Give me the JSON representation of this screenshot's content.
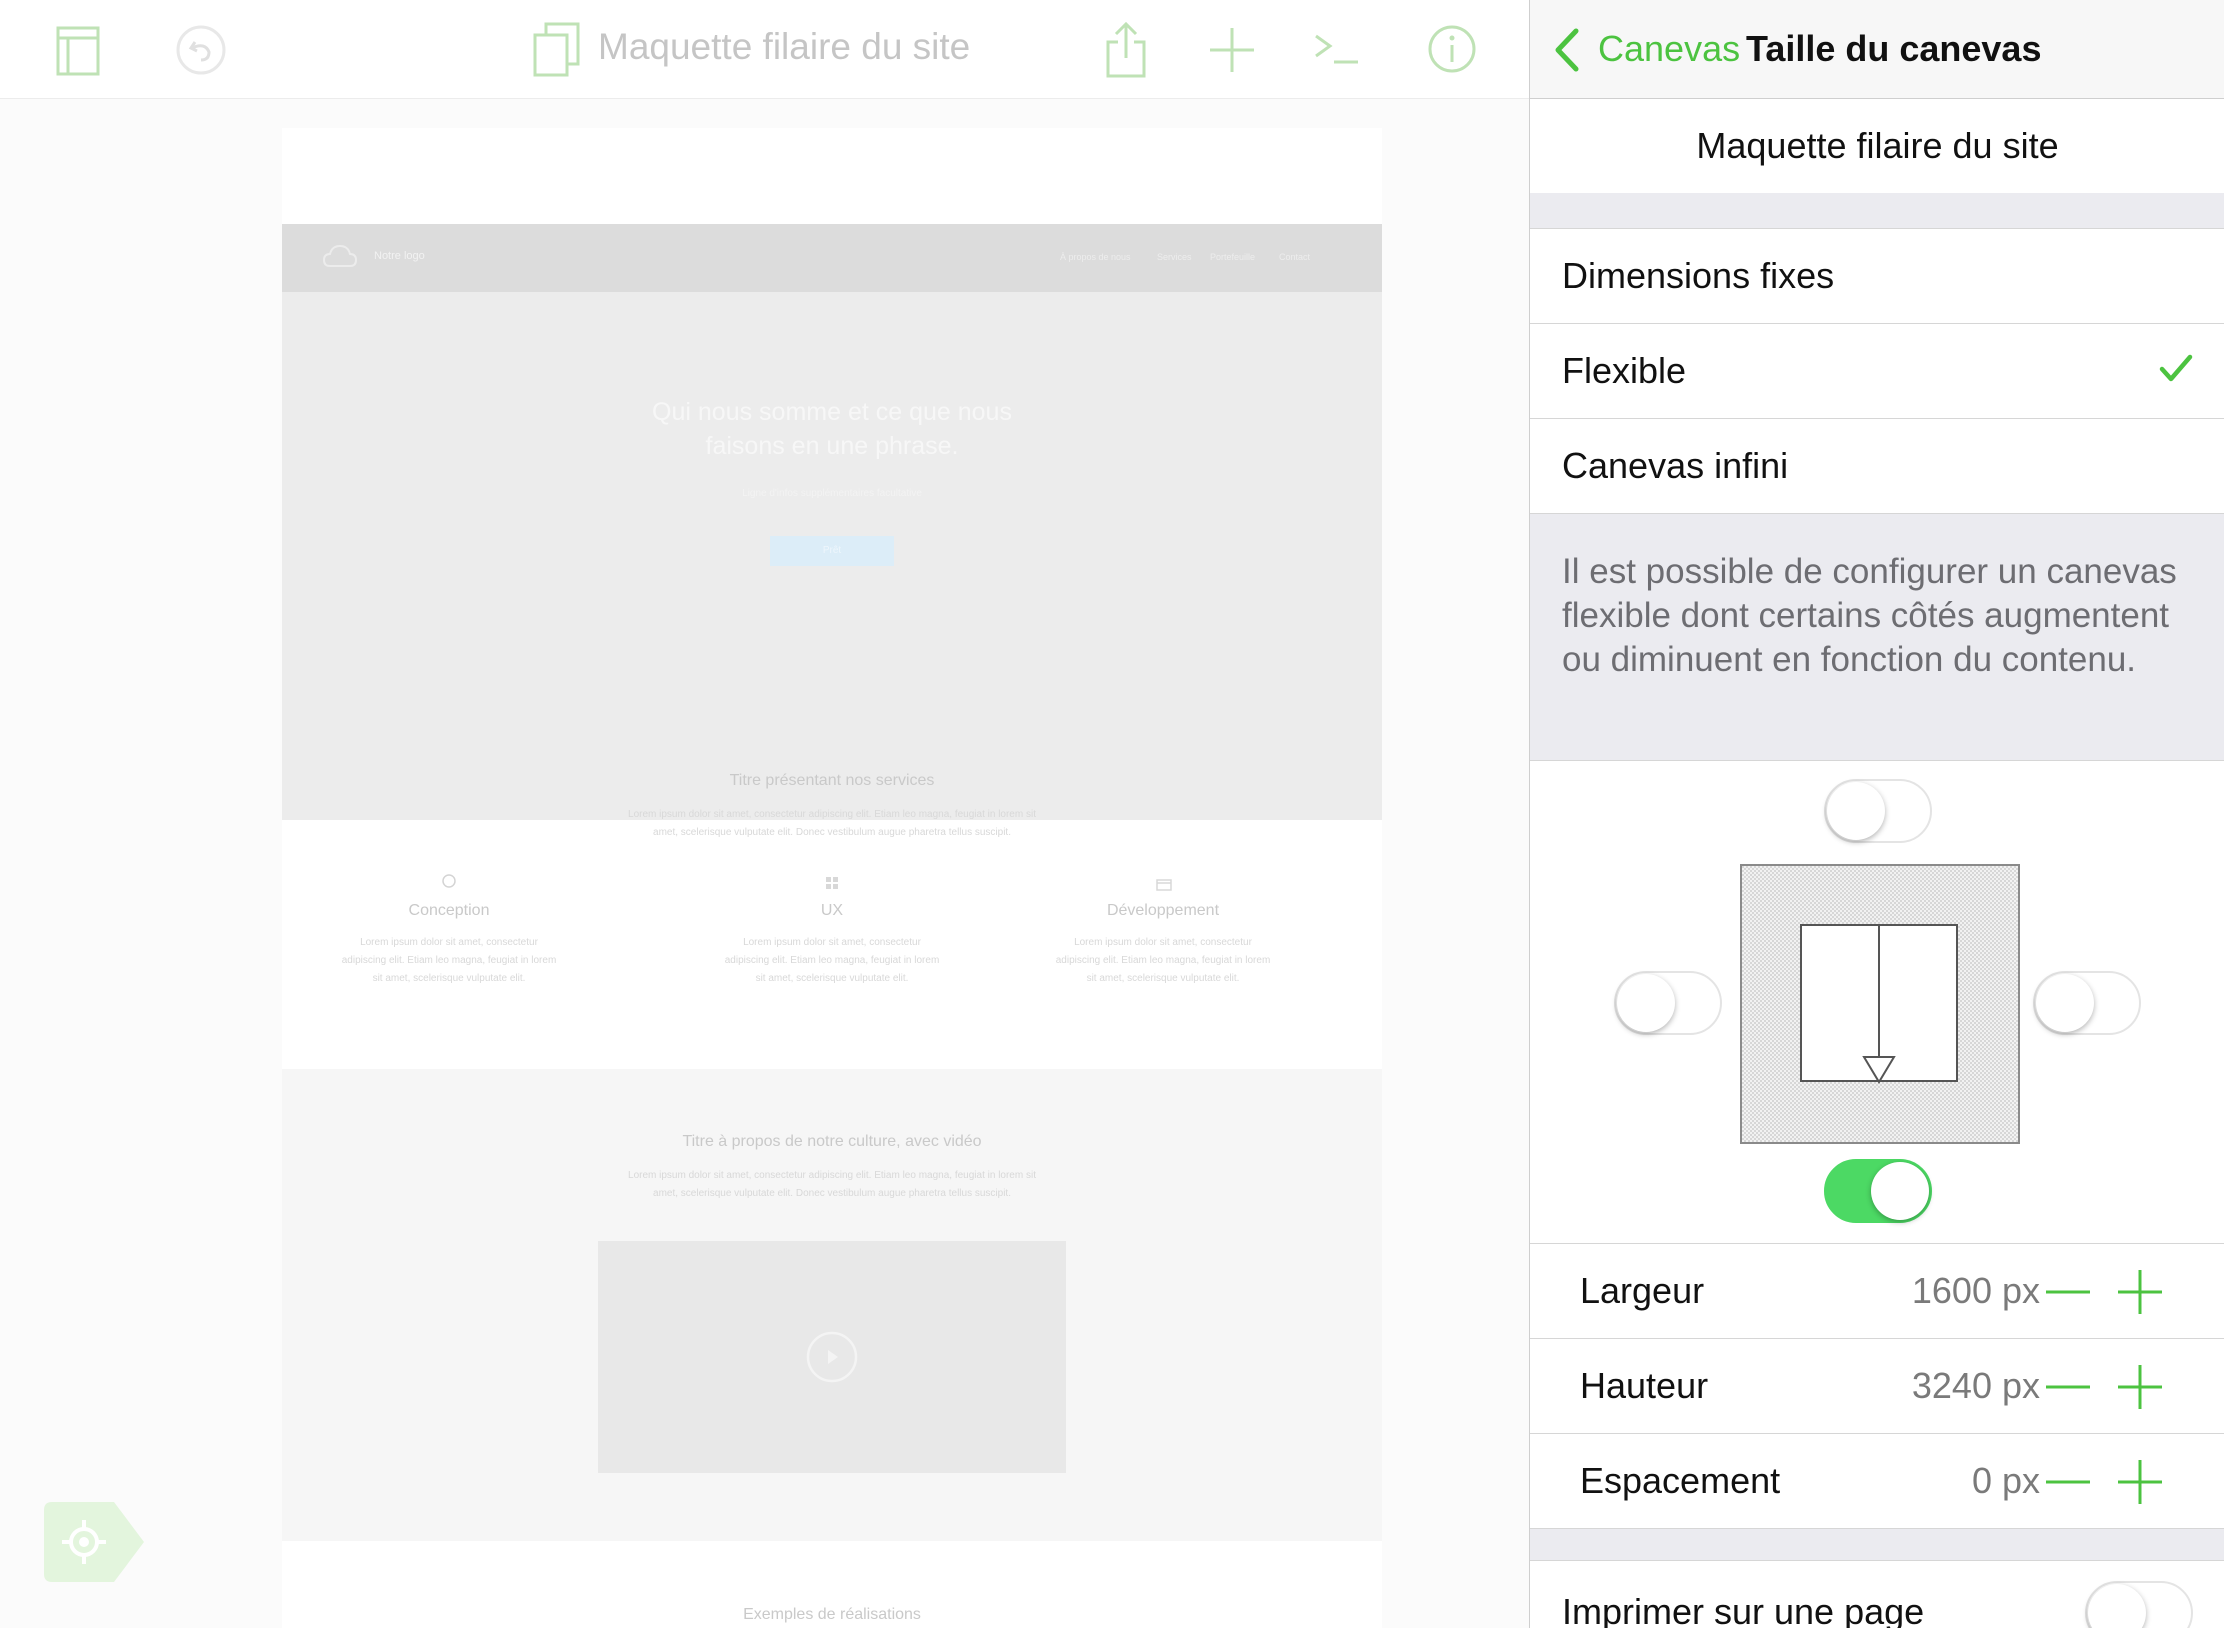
{
  "toolbar": {
    "document_title": "Maquette filaire du site",
    "icons": [
      "sidebar-icon",
      "undo-icon",
      "documents-icon",
      "share-icon",
      "add-icon",
      "console-icon",
      "info-icon"
    ]
  },
  "canvas_preview": {
    "logo_label": "Notre logo",
    "nav_links": [
      "À propos de nous",
      "Services",
      "Portefeuille",
      "Contact"
    ],
    "hero_title_line1": "Qui nous somme et ce que nous",
    "hero_title_line2": "faisons en une phrase.",
    "hero_subtitle": "Ligne d'infos supplémentaires facultative",
    "hero_button": "Prêt",
    "services_title": "Titre présentant nos services",
    "services_text_1": "Lorem ipsum dolor sit amet, consectetur adipiscing elit. Etiam leo magna, feugiat in lorem sit",
    "services_text_2": "amet, scelerisque vulputate elit. Donec vestibulum augue pharetra tellus suscipit.",
    "columns": [
      {
        "title": "Conception",
        "text1": "Lorem ipsum dolor sit amet, consectetur",
        "text2": "adipiscing elit. Etiam leo magna, feugiat in lorem",
        "text3": "sit amet, scelerisque vulputate elit."
      },
      {
        "title": "UX",
        "text1": "Lorem ipsum dolor sit amet, consectetur",
        "text2": "adipiscing elit. Etiam leo magna, feugiat in lorem",
        "text3": "sit amet, scelerisque vulputate elit."
      },
      {
        "title": "Développement",
        "text1": "Lorem ipsum dolor sit amet, consectetur",
        "text2": "adipiscing elit. Etiam leo magna, feugiat in lorem",
        "text3": "sit amet, scelerisque vulputate elit."
      }
    ],
    "culture_title": "Titre à propos de notre culture, avec vidéo",
    "culture_text_1": "Lorem ipsum dolor sit amet, consectetur adipiscing elit. Etiam leo magna, feugiat in lorem sit",
    "culture_text_2": "amet, scelerisque vulputate elit. Donec vestibulum augue pharetra tellus suscipit.",
    "examples_title": "Exemples de réalisations"
  },
  "panel": {
    "back_label": "Canevas",
    "title": "Taille du canevas",
    "canvas_name": "Maquette filaire du site",
    "size_options": [
      {
        "label": "Dimensions fixes",
        "selected": false
      },
      {
        "label": "Flexible",
        "selected": true
      },
      {
        "label": "Canevas infini",
        "selected": false
      }
    ],
    "checkmark": "✓",
    "description": "Il est possible de configurer un canevas flexible dont certains côtés augmentent ou diminuent en fonction du contenu.",
    "edge_toggles": {
      "top": false,
      "left": false,
      "right": false,
      "bottom": true
    },
    "dimensions": [
      {
        "label": "Largeur",
        "value": "1600 px"
      },
      {
        "label": "Hauteur",
        "value": "3240 px"
      },
      {
        "label": "Espacement",
        "value": "0 px"
      }
    ],
    "print_label": "Imprimer sur une page",
    "print_toggle": false
  },
  "colors": {
    "accent": "#4cc340",
    "toggle_on": "#4cd964",
    "panel_bg": "#ebebf0"
  }
}
